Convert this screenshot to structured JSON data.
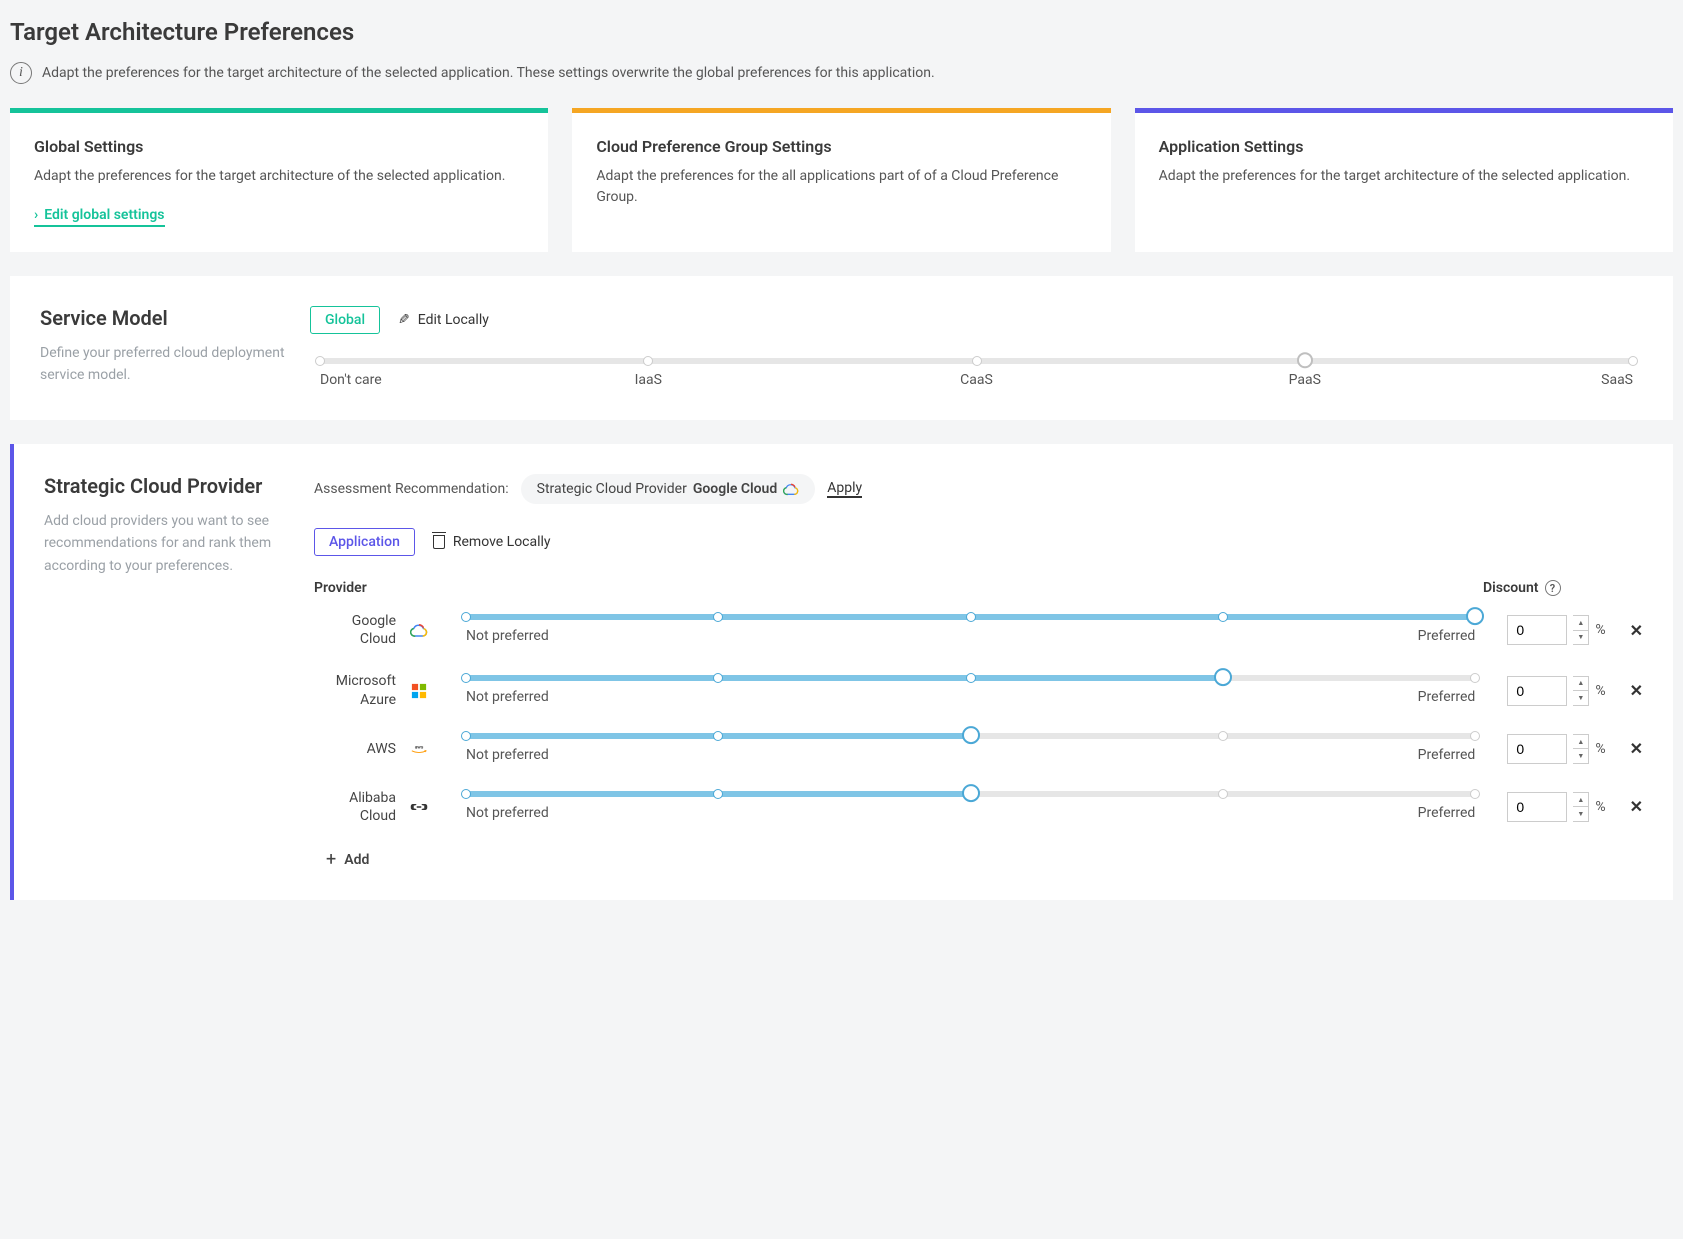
{
  "page": {
    "title": "Target Architecture Preferences",
    "info_text": "Adapt the preferences for the target architecture of the selected application. These settings overwrite the global preferences for this application."
  },
  "cards": {
    "global": {
      "title": "Global Settings",
      "body": "Adapt the preferences for the target architecture of the selected application.",
      "link_label": "Edit global settings"
    },
    "group": {
      "title": "Cloud Preference Group Settings",
      "body": "Adapt the preferences for the all applications part of of a Cloud Preference Group."
    },
    "app": {
      "title": "Application Settings",
      "body": "Adapt the preferences for the target architecture of the selected application."
    }
  },
  "service_model": {
    "title": "Service Model",
    "desc": "Define your preferred cloud deployment service model.",
    "scope_badge": "Global",
    "edit_label": "Edit Locally",
    "ticks": [
      "Don't care",
      "IaaS",
      "CaaS",
      "PaaS",
      "SaaS"
    ],
    "selected_index": 3
  },
  "strategic": {
    "title": "Strategic Cloud Provider",
    "desc": "Add cloud providers you want to see recommendations for and rank them according to your preferences.",
    "assessment_prefix": "Assessment Recommendation:",
    "pill_prefix": "Strategic Cloud Provider",
    "pill_value": "Google Cloud",
    "apply_label": "Apply",
    "scope_badge": "Application",
    "remove_label": "Remove Locally",
    "col_provider": "Provider",
    "col_discount": "Discount",
    "slider_left": "Not preferred",
    "slider_right": "Preferred",
    "pct_symbol": "%",
    "add_label": "Add",
    "providers": [
      {
        "name": "Google Cloud",
        "preference_index": 4,
        "discount": "0"
      },
      {
        "name": "Microsoft Azure",
        "preference_index": 3,
        "discount": "0"
      },
      {
        "name": "AWS",
        "preference_index": 2,
        "discount": "0"
      },
      {
        "name": "Alibaba Cloud",
        "preference_index": 2,
        "discount": "0"
      }
    ]
  }
}
